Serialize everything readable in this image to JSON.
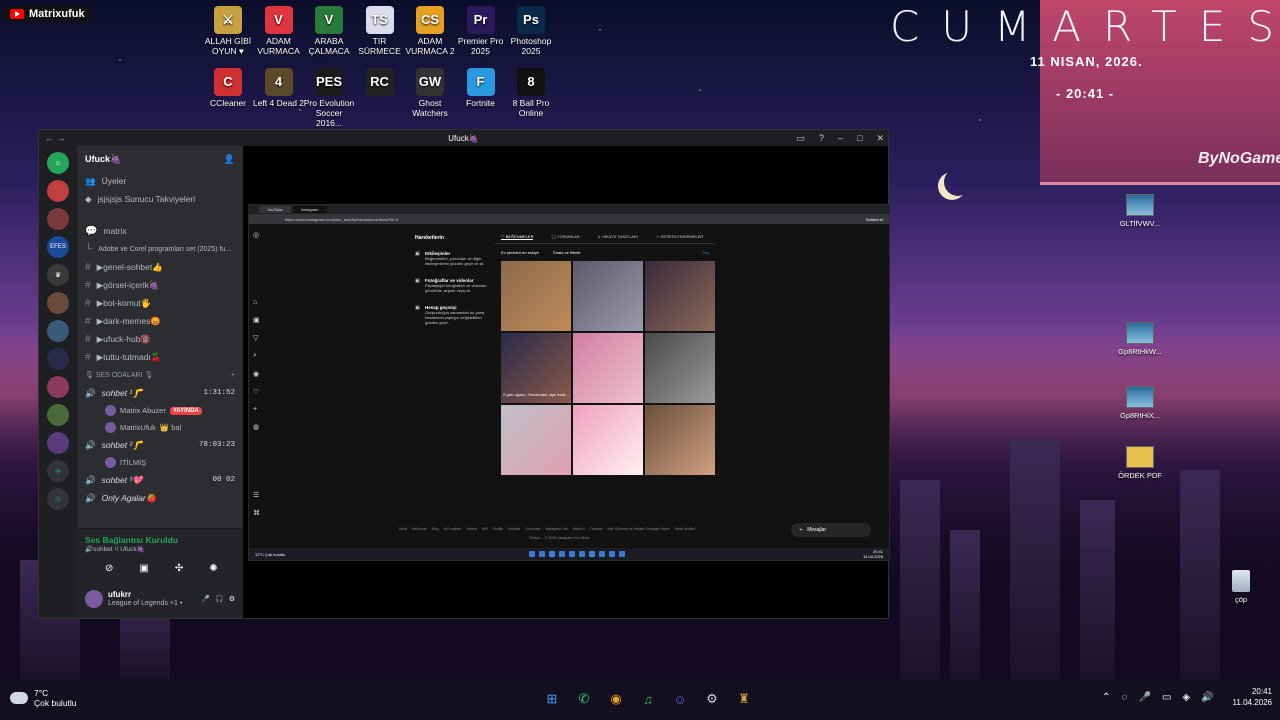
{
  "desktop": {
    "youtube_user": "Matrixufuk",
    "icons": [
      {
        "label": "ALLAH GİBİ OYUN ♥",
        "glyph": "⚔",
        "color": "#c8a040"
      },
      {
        "label": "ADAM VURMACA",
        "glyph": "V",
        "color": "#e0343f"
      },
      {
        "label": "ARABA ÇALMACA",
        "glyph": "V",
        "color": "#2a7a3a"
      },
      {
        "label": "TIR SÜRMECE",
        "glyph": "TS",
        "color": "#dde"
      },
      {
        "label": "ADAM VURMACA 2",
        "glyph": "CS",
        "color": "#e8a020"
      },
      {
        "label": "Premier Pro 2025",
        "glyph": "Pr",
        "color": "#2a1a5a"
      },
      {
        "label": "Photoshop 2025",
        "glyph": "Ps",
        "color": "#0a2a4a"
      },
      {
        "label": "CCleaner",
        "glyph": "C",
        "color": "#d03030"
      },
      {
        "label": "Left 4 Dead 2",
        "glyph": "4",
        "color": "#5a4a2a"
      },
      {
        "label": "Pro Evolution Soccer 2016...",
        "glyph": "PES",
        "color": "#1a1a1a"
      },
      {
        "label": "",
        "glyph": "RC",
        "color": "#222"
      },
      {
        "label": "Ghost Watchers",
        "glyph": "GW",
        "color": "#333"
      },
      {
        "label": "Fortnite",
        "glyph": "F",
        "color": "#2a9ae0"
      },
      {
        "label": "8 Ball Pro Online",
        "glyph": "8",
        "color": "#111"
      }
    ],
    "clock": {
      "day": "CUMARTESI",
      "date": "11 NISAN, 2026.",
      "time": "- 20:41 -"
    },
    "signature": "ByNoGame",
    "right_icons": [
      {
        "label": "GLTlfVWV..."
      },
      {
        "label": "Gp8RtHkW..."
      },
      {
        "label": "Gp8RtHiX..."
      },
      {
        "label": "ÖRDEK PDF"
      }
    ],
    "recycle_label": "çöp"
  },
  "window": {
    "title": "Ufuck🍇",
    "server_name": "Ufuck🍇",
    "members_label": "Üyeler",
    "boost_label": "jsjsjsjs Sunucu Takviyeleri",
    "overlay_text": "Matrix Abuzer:",
    "channels": [
      {
        "name": "matrix",
        "kind": "forum"
      },
      {
        "name": "Adobe ve Corel programları set (2025) fu...",
        "kind": "thread"
      },
      {
        "name": "▶genel-sohbet👍",
        "kind": "text"
      },
      {
        "name": "▶görsel-içerik🍇",
        "kind": "text"
      },
      {
        "name": "▶bot-komut🖐",
        "kind": "text"
      },
      {
        "name": "▶dark-memes😡",
        "kind": "text"
      },
      {
        "name": "▶ufuck-hub🔞",
        "kind": "text"
      },
      {
        "name": "▶tuttu-tutmadı🍒",
        "kind": "text"
      }
    ],
    "voice_category": "🎙 SES ODALARI 🎙",
    "voice": [
      {
        "name": "sohbet ¹🦵",
        "time": "1:31:52",
        "users": [
          {
            "name": "Matrix Abuzer",
            "live": "YAYINDA"
          },
          {
            "name": "MatrixUfuk",
            "note": "👑 bal"
          }
        ]
      },
      {
        "name": "sohbet ²🦵",
        "time": "78:03:23",
        "users": [
          {
            "name": "İTİLMİŞ"
          }
        ]
      },
      {
        "name": "sohbet ³💖",
        "counts": [
          "00",
          "02"
        ]
      },
      {
        "name": "Only Agalar🍓"
      }
    ],
    "voice_status": {
      "title": "Ses Bağlantısı Kuruldu",
      "sub": "🔊sohbet ¹/ Ufuck🍇"
    },
    "user": {
      "name": "ufukrr",
      "status": "League of Legends +1 •"
    }
  },
  "browser": {
    "tabs": [
      "YouTube",
      "Instagram"
    ],
    "url": "https://www.instagram.com/your_activity/interactions/likes/?hl=tr",
    "profile": "Sohbet et",
    "ig_panel_title": "Hareketlerin",
    "ig_panel_items": [
      {
        "t": "Etkileşimler",
        "d": "Beğenmeleri, yorumları ve diğer etkileşimlerini gözden geçir ve sil."
      },
      {
        "t": "Fotoğraflar ve videolar",
        "d": "Paylaştığın fotoğrafları ve videoları görüntüle, arşivle veya sil."
      },
      {
        "t": "Hesap geçmişi",
        "d": "Oluşturduğun zamandan bu yana hesabında yaptığın değişiklikleri gözden geçir."
      }
    ],
    "ig_tabs": [
      "♡ BEĞENMELER",
      "◯ YORUMLAR",
      "↳ HİKAYE YANITLARI",
      "☆ DEĞERLENDİRMELER"
    ],
    "ig_sort": [
      "En yeniden en eskiye",
      "Sırala ve filtrele"
    ],
    "ig_select": "Seç",
    "ig_cells": [
      {
        "c1": "#8a6a4a",
        "c2": "#c08a5a"
      },
      {
        "c1": "#5a5a6a",
        "c2": "#9a9aaa"
      },
      {
        "c1": "#3a2a3a",
        "c2": "#8a6a5a"
      },
      {
        "c1": "#2a2a4a",
        "c2": "#8a5a4a",
        "caption": "Z gün uğunu; Tanıdımadı diye evde..."
      },
      {
        "c1": "#d080a0",
        "c2": "#f0c0d0"
      },
      {
        "c1": "#4a4a4a",
        "c2": "#9a9a9a"
      },
      {
        "c1": "#c0c0c8",
        "c2": "#e0a0b0"
      },
      {
        "c1": "#f0a0c0",
        "c2": "#fff0f0"
      },
      {
        "c1": "#6a5040",
        "c2": "#d0a080"
      }
    ],
    "ig_footer": [
      "Meta",
      "Hakkında",
      "Blog",
      "İş Fırsatları",
      "Yardım",
      "API",
      "Gizlilik",
      "Koşullar",
      "Konumlar",
      "Instagram Lite",
      "Meta AI",
      "Threads",
      "Kişi Yükleme ve Hesabı Olmayan Kişiler",
      "Meta Verified"
    ],
    "ig_copy": "Türkçe ⌄   © 2026 Instagram from Meta",
    "ig_messages": "Mesajlar",
    "mini_weather": "12°C Çok bulutlu",
    "mini_time": "20:41",
    "mini_date": "11.04.2026"
  },
  "taskbar": {
    "weather_temp": "7°C",
    "weather_desc": "Çok bulutlu",
    "apps": [
      {
        "name": "windows-start",
        "glyph": "⊞",
        "color": "#3aa0ff"
      },
      {
        "name": "whatsapp",
        "glyph": "✆",
        "color": "#25d366"
      },
      {
        "name": "chrome",
        "glyph": "◉",
        "color": "#e8a020"
      },
      {
        "name": "spotify",
        "glyph": "♫",
        "color": "#1db954"
      },
      {
        "name": "discord",
        "glyph": "☺",
        "color": "#5865f2"
      },
      {
        "name": "steam",
        "glyph": "⚙",
        "color": "#c6d4df"
      },
      {
        "name": "league",
        "glyph": "♜",
        "color": "#c8a040"
      }
    ],
    "time": "20:41",
    "date": "11.04.2026"
  }
}
